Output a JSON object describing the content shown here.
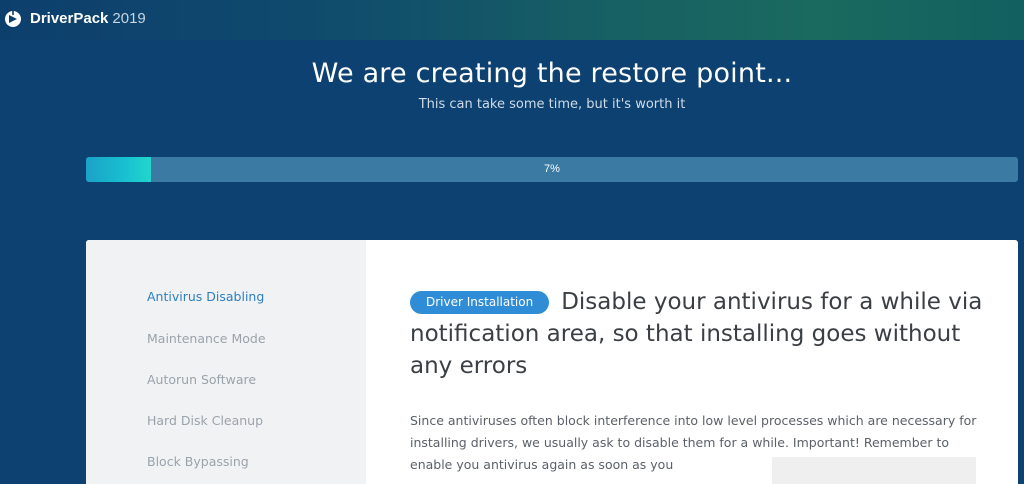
{
  "app": {
    "name_bold": "DriverPack",
    "name_version": "2019"
  },
  "header": {
    "title": "We are creating the restore point...",
    "subtitle": "This can take some time, but it's worth it"
  },
  "progress": {
    "percent": 7,
    "label": "7%"
  },
  "sidebar": {
    "steps": [
      {
        "label": "Antivirus Disabling",
        "active": true
      },
      {
        "label": "Maintenance Mode",
        "active": false
      },
      {
        "label": "Autorun Software",
        "active": false
      },
      {
        "label": "Hard Disk Cleanup",
        "active": false
      },
      {
        "label": "Block Bypassing",
        "active": false
      }
    ]
  },
  "main": {
    "tag": "Driver Installation",
    "title": "Disable your antivirus for a while via notification area, so that installing goes without any errors",
    "description": "Since antiviruses often block interference into low level processes which are necessary for installing drivers, we usually ask to disable them for a while. Important! Remember to enable you antivirus again as soon as you"
  },
  "colors": {
    "background": "#0c4171",
    "accent": "#2f8cd6",
    "progress_fill": "#22d6cd",
    "active_step": "#2d7fc2"
  },
  "icons": {
    "logo": "driverpack-logo-icon"
  }
}
